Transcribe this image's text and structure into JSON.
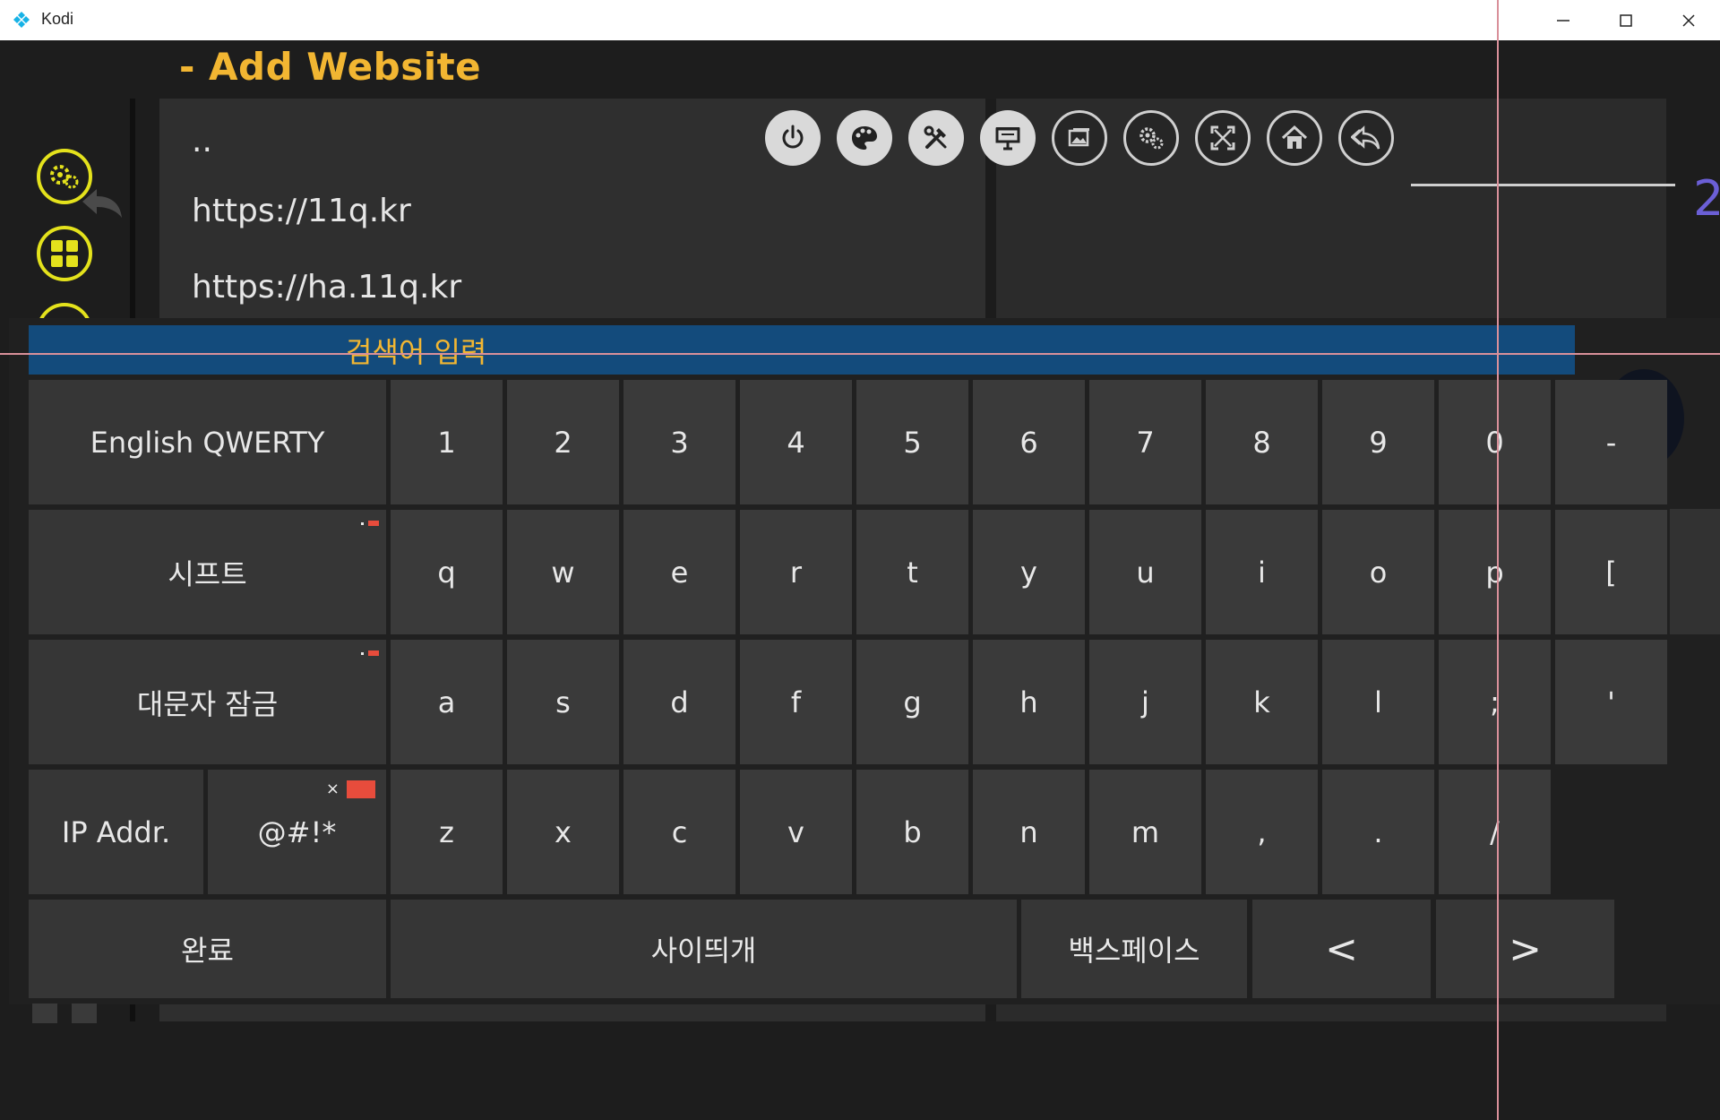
{
  "window": {
    "title": "Kodi",
    "minimize_icon": "minimize-icon",
    "maximize_icon": "maximize-icon",
    "close_icon": "close-icon"
  },
  "header": {
    "title": "- Add Website"
  },
  "sidebar": {
    "icons": [
      "settings-gears-icon",
      "add-ons-grid-icon",
      "info-icon"
    ]
  },
  "file_list": {
    "items": [
      {
        "label": ".."
      },
      {
        "label": "https://11q.kr"
      },
      {
        "label": "https://ha.11q.kr"
      }
    ]
  },
  "toolbar": {
    "buttons": [
      {
        "icon": "power-icon"
      },
      {
        "icon": "paint-palette-icon"
      },
      {
        "icon": "tools-icon"
      },
      {
        "icon": "presentation-icon"
      },
      {
        "icon": "pictures-icon"
      },
      {
        "icon": "settings-gears-icon"
      },
      {
        "icon": "fullscreen-icon"
      },
      {
        "icon": "home-icon"
      },
      {
        "icon": "back-arrow-icon"
      }
    ]
  },
  "keyboard": {
    "input_placeholder": "검색어 입력",
    "layout_button": "English QWERTY",
    "shift_button": "시프트",
    "capslock_button": "대문자 잠금",
    "ip_button": "IP Addr.",
    "symbols_button": "@#!*",
    "done_button": "완료",
    "space_button": "사이띄개",
    "backspace_button": "백스페이스",
    "left_button": "<",
    "right_button": ">",
    "row1": [
      "1",
      "2",
      "3",
      "4",
      "5",
      "6",
      "7",
      "8",
      "9",
      "0",
      "-"
    ],
    "row2": [
      "q",
      "w",
      "e",
      "r",
      "t",
      "y",
      "u",
      "i",
      "o",
      "p",
      "["
    ],
    "row3": [
      "a",
      "s",
      "d",
      "f",
      "g",
      "h",
      "j",
      "k",
      "l",
      ";",
      "'"
    ],
    "row4": [
      "z",
      "x",
      "c",
      "v",
      "b",
      "n",
      "m",
      ",",
      ".",
      "/"
    ]
  },
  "colors": {
    "accent": "#f2b632",
    "input_bar": "#134b7c",
    "badge_red": "#e74c3c",
    "sidebar_icon": "#e4e21c"
  }
}
